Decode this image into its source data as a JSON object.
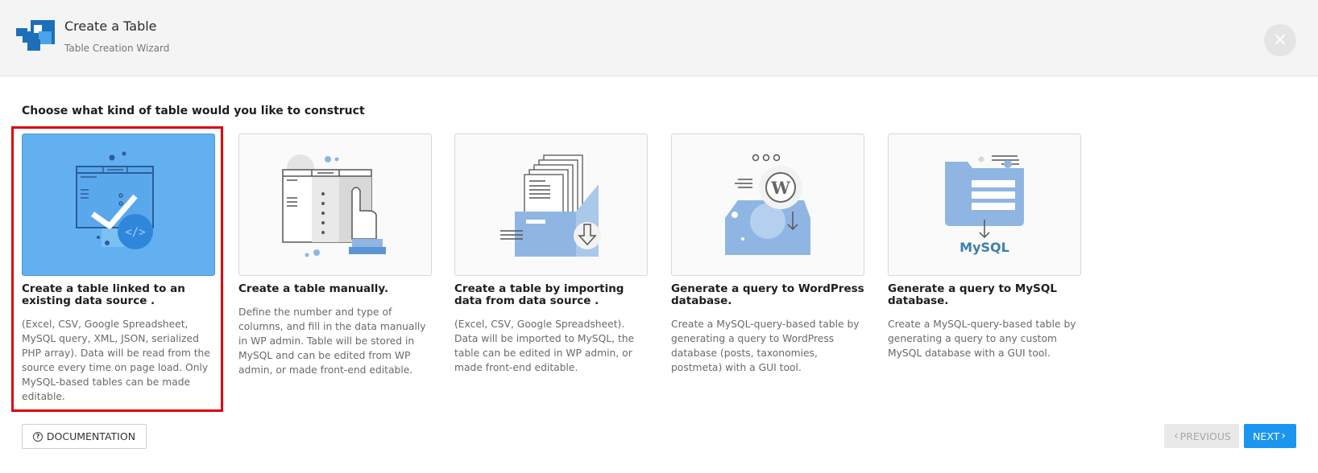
{
  "header": {
    "title": "Create a Table",
    "subtitle": "Table Creation Wizard",
    "close_icon": "close-icon"
  },
  "prompt": "Choose what kind of table would you like to construct",
  "cards": [
    {
      "title": "Create a table linked to an existing data source .",
      "description": "(Excel, CSV, Google Spreadsheet, MySQL query, XML, JSON, serialized PHP array). Data will be read from the source every time on page load. Only MySQL-based tables can be made editable.",
      "selected": true,
      "icon": "linked-data-source-illustration"
    },
    {
      "title": "Create a table manually.",
      "description": "Define the number and type of columns, and fill in the data manually in WP admin. Table will be stored in MySQL and can be edited from WP admin, or made front-end editable.",
      "selected": false,
      "icon": "manual-table-illustration"
    },
    {
      "title": "Create a table by importing data from data source .",
      "description": "(Excel, CSV, Google Spreadsheet). Data will be imported to MySQL, the table can be edited in WP admin, or made front-end editable.",
      "selected": false,
      "icon": "import-data-illustration"
    },
    {
      "title": "Generate a query to WordPress database.",
      "description": "Create a MySQL-query-based table by generating a query to WordPress database (posts, taxonomies, postmeta) with a GUI tool.",
      "selected": false,
      "icon": "wordpress-query-illustration"
    },
    {
      "title": "Generate a query to MySQL database.",
      "description": "Create a MySQL-query-based table by generating a query to any custom MySQL database with a GUI tool.",
      "selected": false,
      "icon": "mysql-query-illustration"
    }
  ],
  "mysql_logo_text": "MySQL",
  "footer": {
    "documentation_label": "DOCUMENTATION",
    "previous_label": "PREVIOUS",
    "next_label": "NEXT"
  },
  "colors": {
    "accent": "#1a96f0",
    "selected_card": "#62b0ef",
    "selection_frame": "#e0000a",
    "illustration_blue": "#8fb6e2"
  }
}
